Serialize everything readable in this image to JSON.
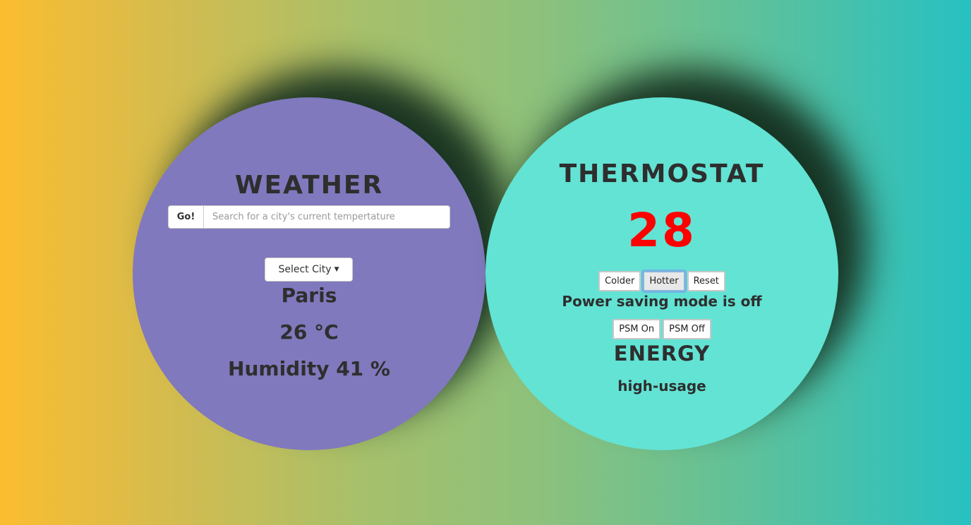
{
  "weather": {
    "title": "WEATHER",
    "go_label": "Go!",
    "search_placeholder": "Search for a city's current tempertature",
    "search_value": "",
    "select_city_label": "Select City",
    "city": "Paris",
    "temperature": "26 °C",
    "humidity": "Humidity 41 %"
  },
  "thermostat": {
    "title": "THERMOSTAT",
    "temperature": "28",
    "colder_label": "Colder",
    "hotter_label": "Hotter",
    "reset_label": "Reset",
    "psm_status": "Power saving mode is off",
    "psm_on_label": "PSM On",
    "psm_off_label": "PSM Off",
    "energy_title": "ENERGY",
    "energy_usage": "high-usage"
  },
  "colors": {
    "weather_bg": "#8079bd",
    "thermostat_bg": "#62e3d4",
    "temperature_text": "#ff0000"
  },
  "icons": {
    "select_city_caret": "caret-down-icon"
  }
}
